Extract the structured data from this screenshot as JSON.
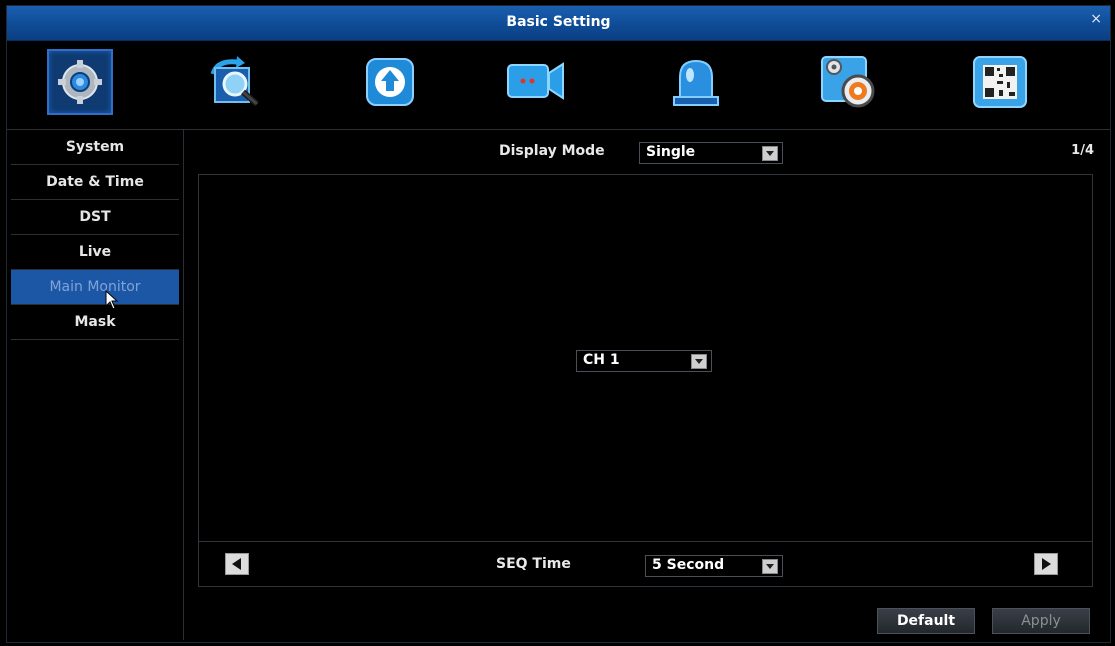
{
  "window": {
    "title": "Basic Setting",
    "close_glyph": "×"
  },
  "toolbar": {
    "icons": [
      "system-settings-icon",
      "search-playback-icon",
      "backup-upload-icon",
      "record-camera-icon",
      "alarm-siren-icon",
      "advanced-settings-icon",
      "info-qrcode-icon"
    ],
    "active_index": 0
  },
  "sidebar": {
    "items": [
      {
        "label": "System"
      },
      {
        "label": "Date & Time"
      },
      {
        "label": "DST"
      },
      {
        "label": "Live"
      },
      {
        "label": "Main Monitor"
      },
      {
        "label": "Mask"
      }
    ],
    "active": "Main Monitor"
  },
  "main": {
    "display_mode_label": "Display Mode",
    "display_mode_value": "Single",
    "page_indicator": "1/4",
    "channel_value": "CH 1",
    "seq_time_label": "SEQ Time",
    "seq_time_value": "5 Second"
  },
  "buttons": {
    "default": "Default",
    "apply": "Apply"
  },
  "colors": {
    "title_bar": "#1553a0",
    "active_item": "#1c57a6",
    "background": "#000000"
  }
}
